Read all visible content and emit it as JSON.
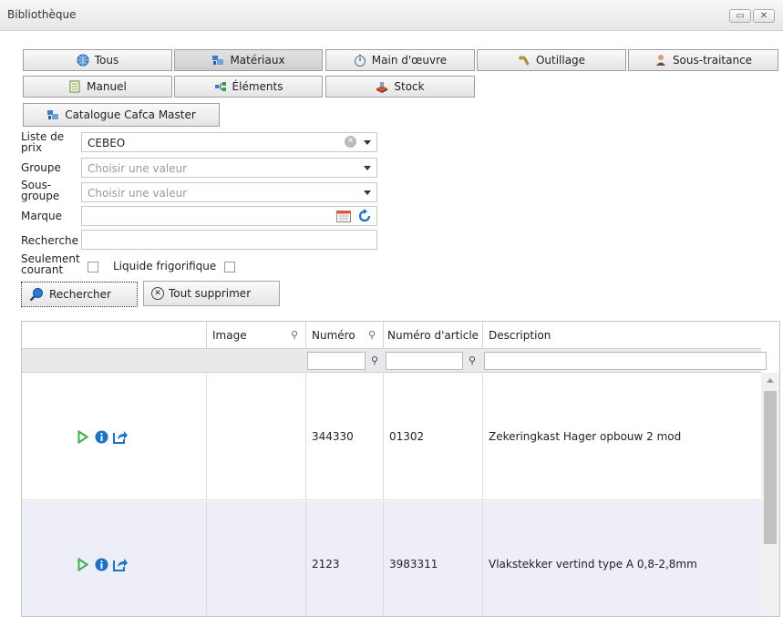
{
  "window": {
    "title": "Bibliothèque"
  },
  "tabs": [
    {
      "label": "Tous",
      "icon": "globe-icon"
    },
    {
      "label": "Matériaux",
      "icon": "materials-icon"
    },
    {
      "label": "Main d'œuvre",
      "icon": "stopwatch-icon"
    },
    {
      "label": "Outillage",
      "icon": "tool-icon"
    },
    {
      "label": "Sous-traitance",
      "icon": "person-icon"
    },
    {
      "label": "Manuel",
      "icon": "document-icon"
    },
    {
      "label": "Éléments",
      "icon": "elements-icon"
    },
    {
      "label": "Stock",
      "icon": "stock-icon"
    },
    {
      "label": "Catalogue Cafca Master",
      "icon": "catalogue-icon"
    }
  ],
  "form": {
    "price_list_label": "Liste de prix",
    "price_list_value": "CEBEO",
    "group_label": "Groupe",
    "group_placeholder": "Choisir une valeur",
    "subgroup_label": "Sous-groupe",
    "subgroup_placeholder": "Choisir une valeur",
    "brand_label": "Marque",
    "search_label": "Recherche",
    "only_current_label": "Seulement courant",
    "refrigerant_label": "Liquide frigorifique",
    "search_button": "Rechercher",
    "clear_button": "Tout supprimer"
  },
  "grid": {
    "columns": [
      "",
      "Image",
      "Numéro",
      "Numéro d'article",
      "Description"
    ],
    "rows": [
      {
        "numero": "344330",
        "article": "01302",
        "description": "Zekeringkast Hager opbouw 2 mod"
      },
      {
        "numero": "2123",
        "article": "3983311",
        "description": "Vlakstekker vertind type A 0,8-2,8mm"
      }
    ]
  },
  "colors": {
    "accent_blue": "#1a73c9",
    "play_green": "#39b54a"
  }
}
